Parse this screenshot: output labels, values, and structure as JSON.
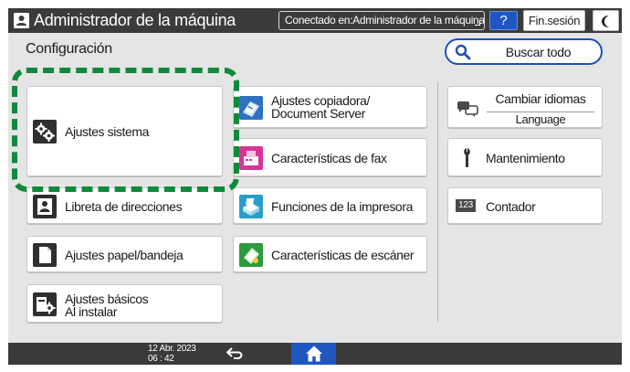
{
  "header": {
    "title": "Administrador de la máquina",
    "connection": "Conectado en:Administrador de la máquina",
    "help_label": "?",
    "logout_label": "Fin.sesión"
  },
  "main": {
    "page_title": "Configuración",
    "search_all_label": "Buscar todo",
    "tiles_left": [
      {
        "label": "Ajustes sistema",
        "icon": "system-settings-icon"
      },
      {
        "label": "Libreta de direcciones",
        "icon": "address-book-icon"
      },
      {
        "label": "Ajustes papel/bandeja",
        "icon": "paper-tray-icon"
      },
      {
        "line1": "Ajustes básicos",
        "line2": "Al instalar",
        "icon": "initial-setup-icon"
      }
    ],
    "tiles_middle": [
      {
        "line1": "Ajustes copiadora/",
        "line2": "Document Server",
        "icon": "copier-icon"
      },
      {
        "label": "Características de fax",
        "icon": "fax-icon"
      },
      {
        "label": "Funciones de la impresora",
        "icon": "printer-icon"
      },
      {
        "label": "Características de escáner",
        "icon": "scanner-icon"
      }
    ],
    "tiles_right": [
      {
        "line1": "Cambiar idiomas",
        "line2": "Language",
        "icon": "language-icon"
      },
      {
        "label": "Mantenimiento",
        "icon": "wrench-icon"
      },
      {
        "label": "Contador",
        "icon": "counter-icon",
        "badge": "123"
      }
    ]
  },
  "footer": {
    "date": "12 Abr. 2023",
    "time": "06 : 42"
  },
  "colors": {
    "accent_blue": "#1f56c2",
    "highlight_green": "#0f8a3a",
    "bar_dark": "#3a3a3a",
    "panel_gray": "#e5e5e5"
  }
}
